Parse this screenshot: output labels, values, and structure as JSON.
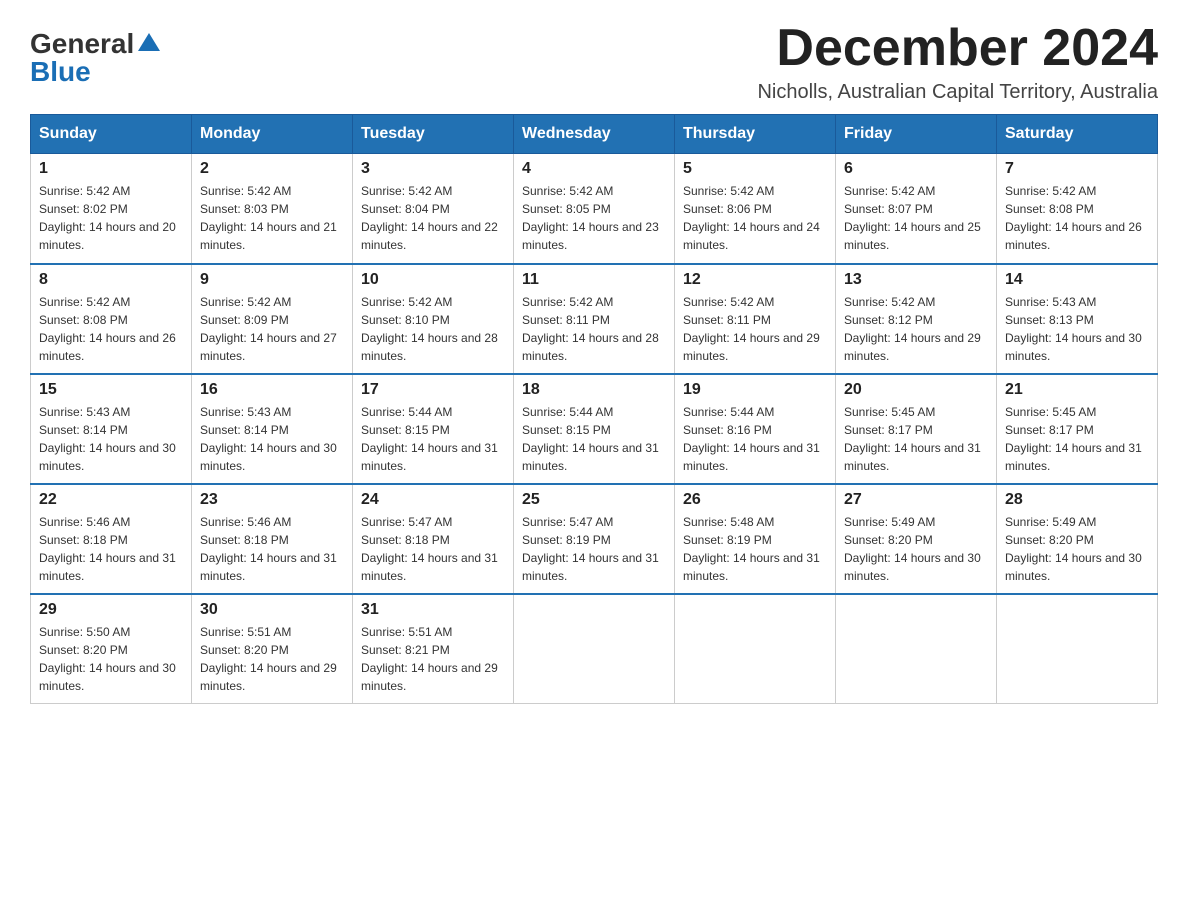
{
  "header": {
    "logo_general": "General",
    "logo_blue": "Blue",
    "month_title": "December 2024",
    "location": "Nicholls, Australian Capital Territory, Australia"
  },
  "weekdays": [
    "Sunday",
    "Monday",
    "Tuesday",
    "Wednesday",
    "Thursday",
    "Friday",
    "Saturday"
  ],
  "weeks": [
    [
      {
        "day": "1",
        "sunrise": "5:42 AM",
        "sunset": "8:02 PM",
        "daylight": "14 hours and 20 minutes."
      },
      {
        "day": "2",
        "sunrise": "5:42 AM",
        "sunset": "8:03 PM",
        "daylight": "14 hours and 21 minutes."
      },
      {
        "day": "3",
        "sunrise": "5:42 AM",
        "sunset": "8:04 PM",
        "daylight": "14 hours and 22 minutes."
      },
      {
        "day": "4",
        "sunrise": "5:42 AM",
        "sunset": "8:05 PM",
        "daylight": "14 hours and 23 minutes."
      },
      {
        "day": "5",
        "sunrise": "5:42 AM",
        "sunset": "8:06 PM",
        "daylight": "14 hours and 24 minutes."
      },
      {
        "day": "6",
        "sunrise": "5:42 AM",
        "sunset": "8:07 PM",
        "daylight": "14 hours and 25 minutes."
      },
      {
        "day": "7",
        "sunrise": "5:42 AM",
        "sunset": "8:08 PM",
        "daylight": "14 hours and 26 minutes."
      }
    ],
    [
      {
        "day": "8",
        "sunrise": "5:42 AM",
        "sunset": "8:08 PM",
        "daylight": "14 hours and 26 minutes."
      },
      {
        "day": "9",
        "sunrise": "5:42 AM",
        "sunset": "8:09 PM",
        "daylight": "14 hours and 27 minutes."
      },
      {
        "day": "10",
        "sunrise": "5:42 AM",
        "sunset": "8:10 PM",
        "daylight": "14 hours and 28 minutes."
      },
      {
        "day": "11",
        "sunrise": "5:42 AM",
        "sunset": "8:11 PM",
        "daylight": "14 hours and 28 minutes."
      },
      {
        "day": "12",
        "sunrise": "5:42 AM",
        "sunset": "8:11 PM",
        "daylight": "14 hours and 29 minutes."
      },
      {
        "day": "13",
        "sunrise": "5:42 AM",
        "sunset": "8:12 PM",
        "daylight": "14 hours and 29 minutes."
      },
      {
        "day": "14",
        "sunrise": "5:43 AM",
        "sunset": "8:13 PM",
        "daylight": "14 hours and 30 minutes."
      }
    ],
    [
      {
        "day": "15",
        "sunrise": "5:43 AM",
        "sunset": "8:14 PM",
        "daylight": "14 hours and 30 minutes."
      },
      {
        "day": "16",
        "sunrise": "5:43 AM",
        "sunset": "8:14 PM",
        "daylight": "14 hours and 30 minutes."
      },
      {
        "day": "17",
        "sunrise": "5:44 AM",
        "sunset": "8:15 PM",
        "daylight": "14 hours and 31 minutes."
      },
      {
        "day": "18",
        "sunrise": "5:44 AM",
        "sunset": "8:15 PM",
        "daylight": "14 hours and 31 minutes."
      },
      {
        "day": "19",
        "sunrise": "5:44 AM",
        "sunset": "8:16 PM",
        "daylight": "14 hours and 31 minutes."
      },
      {
        "day": "20",
        "sunrise": "5:45 AM",
        "sunset": "8:17 PM",
        "daylight": "14 hours and 31 minutes."
      },
      {
        "day": "21",
        "sunrise": "5:45 AM",
        "sunset": "8:17 PM",
        "daylight": "14 hours and 31 minutes."
      }
    ],
    [
      {
        "day": "22",
        "sunrise": "5:46 AM",
        "sunset": "8:18 PM",
        "daylight": "14 hours and 31 minutes."
      },
      {
        "day": "23",
        "sunrise": "5:46 AM",
        "sunset": "8:18 PM",
        "daylight": "14 hours and 31 minutes."
      },
      {
        "day": "24",
        "sunrise": "5:47 AM",
        "sunset": "8:18 PM",
        "daylight": "14 hours and 31 minutes."
      },
      {
        "day": "25",
        "sunrise": "5:47 AM",
        "sunset": "8:19 PM",
        "daylight": "14 hours and 31 minutes."
      },
      {
        "day": "26",
        "sunrise": "5:48 AM",
        "sunset": "8:19 PM",
        "daylight": "14 hours and 31 minutes."
      },
      {
        "day": "27",
        "sunrise": "5:49 AM",
        "sunset": "8:20 PM",
        "daylight": "14 hours and 30 minutes."
      },
      {
        "day": "28",
        "sunrise": "5:49 AM",
        "sunset": "8:20 PM",
        "daylight": "14 hours and 30 minutes."
      }
    ],
    [
      {
        "day": "29",
        "sunrise": "5:50 AM",
        "sunset": "8:20 PM",
        "daylight": "14 hours and 30 minutes."
      },
      {
        "day": "30",
        "sunrise": "5:51 AM",
        "sunset": "8:20 PM",
        "daylight": "14 hours and 29 minutes."
      },
      {
        "day": "31",
        "sunrise": "5:51 AM",
        "sunset": "8:21 PM",
        "daylight": "14 hours and 29 minutes."
      },
      null,
      null,
      null,
      null
    ]
  ]
}
